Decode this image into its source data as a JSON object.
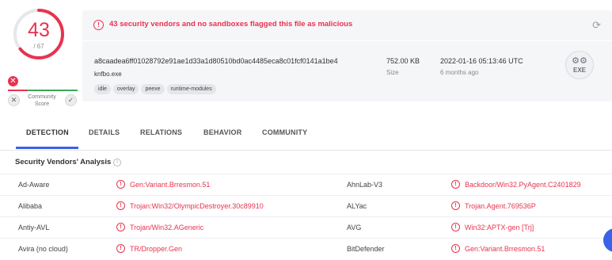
{
  "score": {
    "detections": "43",
    "total": "/ 67",
    "detected_fraction": 0.6418,
    "ring_color": "#e8334f"
  },
  "community": {
    "label_line1": "Community",
    "label_line2": "Score",
    "negative_icon": "close-icon",
    "positive_icon": "check-icon"
  },
  "banner": {
    "icon": "alert-circle-icon",
    "message": "43 security vendors and no sandboxes flagged this file as malicious",
    "refresh_icon": "refresh-icon"
  },
  "file": {
    "hash": "a8caadea6ff01028792e91ae1d33a1d80510bd0ac4485eca8c01fcf0141a1be4",
    "name": "knfbo.exe",
    "tags": [
      "idle",
      "overlay",
      "peexe",
      "runtime-modules"
    ],
    "size_value": "752.00 KB",
    "size_label": "Size",
    "date_value": "2022-01-16 05:13:46 UTC",
    "date_label": "6 months ago",
    "type_label": "EXE"
  },
  "tabs": [
    "DETECTION",
    "DETAILS",
    "RELATIONS",
    "BEHAVIOR",
    "COMMUNITY"
  ],
  "active_tab": "DETECTION",
  "section": {
    "title": "Security Vendors' Analysis",
    "info_icon": "info-icon"
  },
  "detections": [
    {
      "left": {
        "vendor": "Ad-Aware",
        "result": "Gen:Variant.Brresmon.51"
      },
      "right": {
        "vendor": "AhnLab-V3",
        "result": "Backdoor/Win32.PyAgent.C2401829"
      }
    },
    {
      "left": {
        "vendor": "Alibaba",
        "result": "Trojan:Win32/OlympicDestroyer.30c89910"
      },
      "right": {
        "vendor": "ALYac",
        "result": "Trojan.Agent.769536P"
      }
    },
    {
      "left": {
        "vendor": "Antiy-AVL",
        "result": "Trojan/Win32.AGeneric"
      },
      "right": {
        "vendor": "AVG",
        "result": "Win32:APTX-gen [Trj]"
      }
    },
    {
      "left": {
        "vendor": "Avira (no cloud)",
        "result": "TR/Dropper.Gen"
      },
      "right": {
        "vendor": "BitDefender",
        "result": "Gen:Variant.Brresmon.51"
      }
    }
  ],
  "colors": {
    "malicious": "#e8334f",
    "accent": "#3b61ea",
    "panel": "#f5f6f8"
  }
}
